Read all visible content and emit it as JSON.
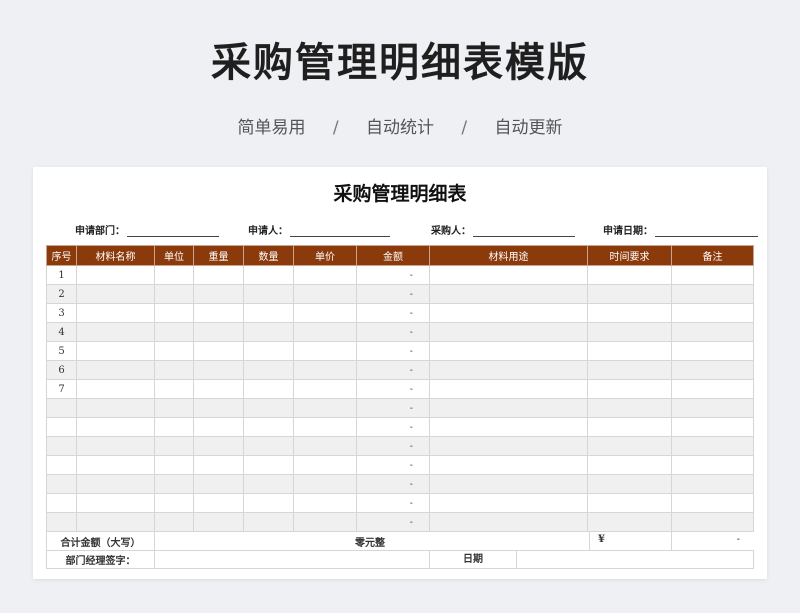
{
  "header": {
    "title": "采购管理明细表模版",
    "tags": [
      "简单易用",
      "自动统计",
      "自动更新"
    ],
    "separator": "/"
  },
  "sheet": {
    "title": "采购管理明细表",
    "meta": {
      "applicant_dept_label": "申请部门：",
      "applicant_label": "申请人：",
      "purchaser_label": "采购人：",
      "apply_date_label": "申请日期："
    },
    "columns": [
      "序号",
      "材料名称",
      "单位",
      "重量",
      "数量",
      "单价",
      "金额",
      "材料用途",
      "时间要求",
      "备注"
    ],
    "rows": [
      {
        "no": "1",
        "amount": "-"
      },
      {
        "no": "2",
        "amount": "-"
      },
      {
        "no": "3",
        "amount": "-"
      },
      {
        "no": "4",
        "amount": "-"
      },
      {
        "no": "5",
        "amount": "-"
      },
      {
        "no": "6",
        "amount": "-"
      },
      {
        "no": "7",
        "amount": "-"
      },
      {
        "no": "",
        "amount": "-"
      },
      {
        "no": "",
        "amount": "-"
      },
      {
        "no": "",
        "amount": "-"
      },
      {
        "no": "",
        "amount": "-"
      },
      {
        "no": "",
        "amount": "-"
      },
      {
        "no": "",
        "amount": "-"
      },
      {
        "no": "",
        "amount": "-"
      }
    ],
    "total": {
      "label": "合计金额（大写）",
      "value_text": "零元整",
      "currency": "¥",
      "value": "-"
    },
    "sign": {
      "manager_label": "部门经理签字：",
      "date_label": "日期"
    }
  },
  "colors": {
    "header_bg": "#8b3a0c",
    "stripe": "#f0f0f0"
  }
}
